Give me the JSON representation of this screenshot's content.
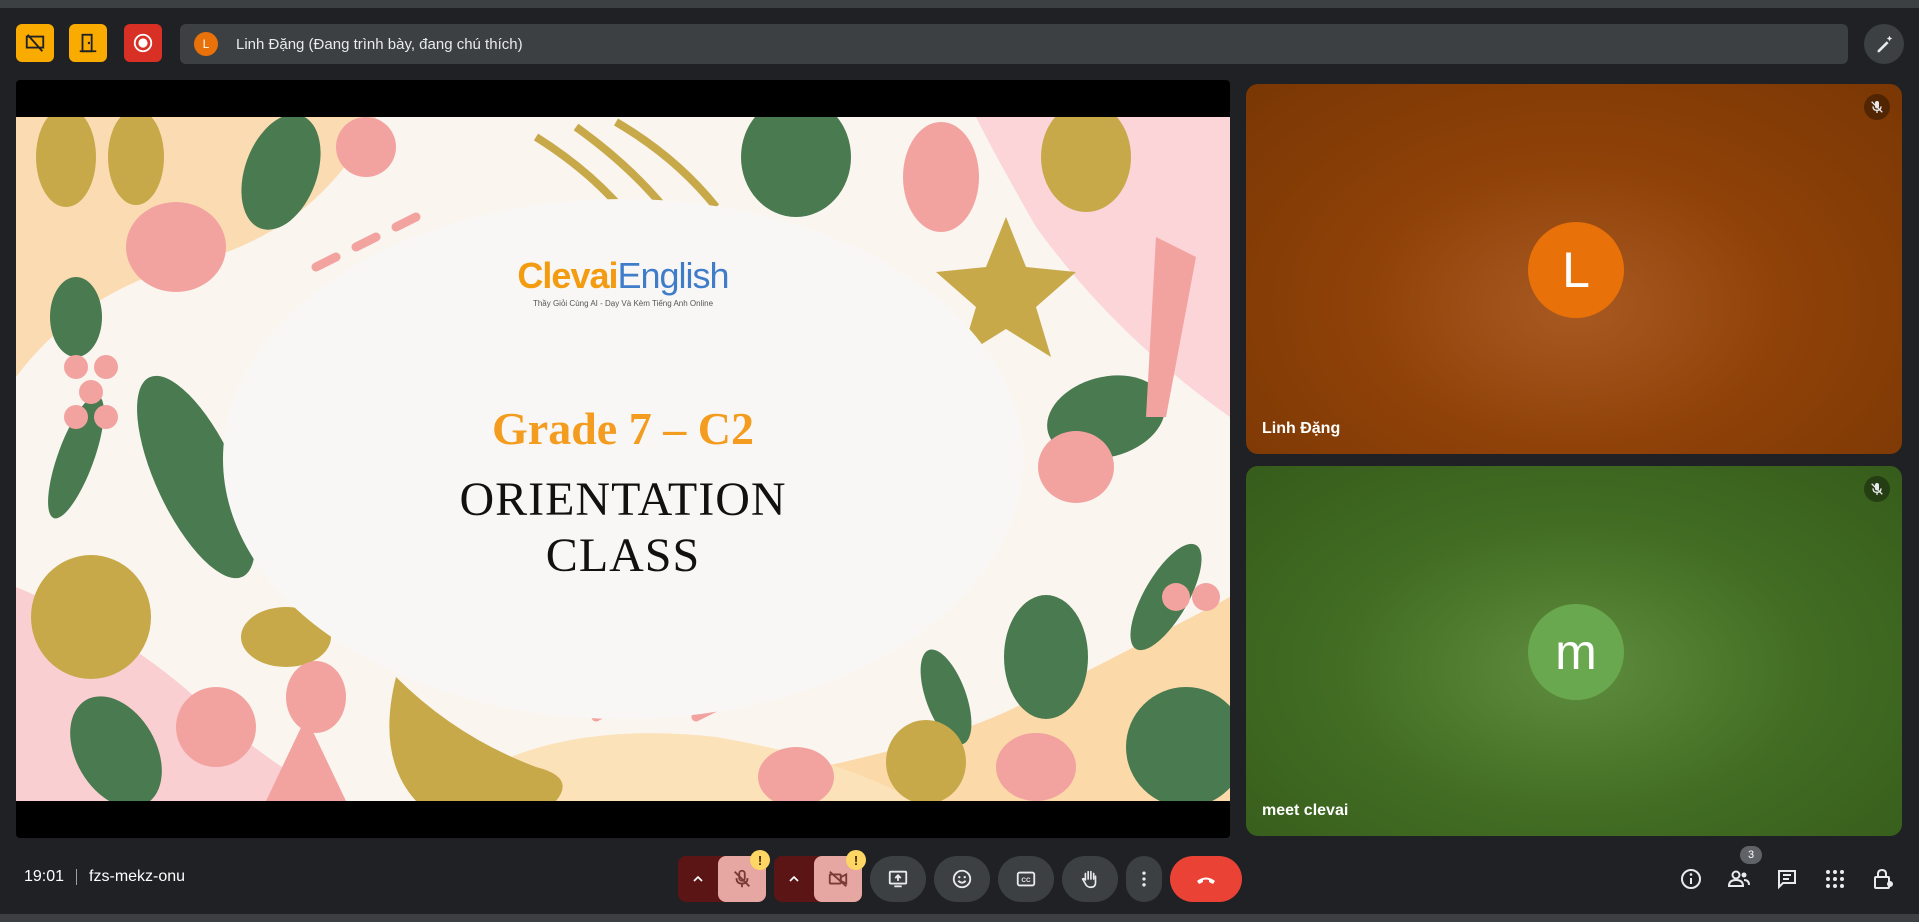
{
  "presenter": {
    "avatar_letter": "L",
    "label": "Linh Đặng (Đang trình bày, đang chú thích)"
  },
  "slide": {
    "logo_part1": "Clevai",
    "logo_part2": "English",
    "logo_tagline": "Thầy Giỏi Cùng AI - Dạy Và Kèm Tiếng Anh Online",
    "grade": "Grade 7 – C2",
    "title_line1": "ORIENTATION",
    "title_line2": "CLASS"
  },
  "participants": [
    {
      "name": "Linh Đặng",
      "avatar_letter": "L",
      "avatar_color": "#e8710a",
      "muted": true
    },
    {
      "name": "meet clevai",
      "avatar_letter": "m",
      "avatar_color": "#6aa84f",
      "muted": true
    }
  ],
  "meeting": {
    "time": "19:01",
    "code": "fzs-mekz-onu",
    "people_count": "3"
  },
  "colors": {
    "accent_yellow": "#f9ab00",
    "record_red": "#d93025",
    "hangup_red": "#ea4335"
  },
  "warnings": {
    "mic": "!",
    "cam": "!"
  }
}
